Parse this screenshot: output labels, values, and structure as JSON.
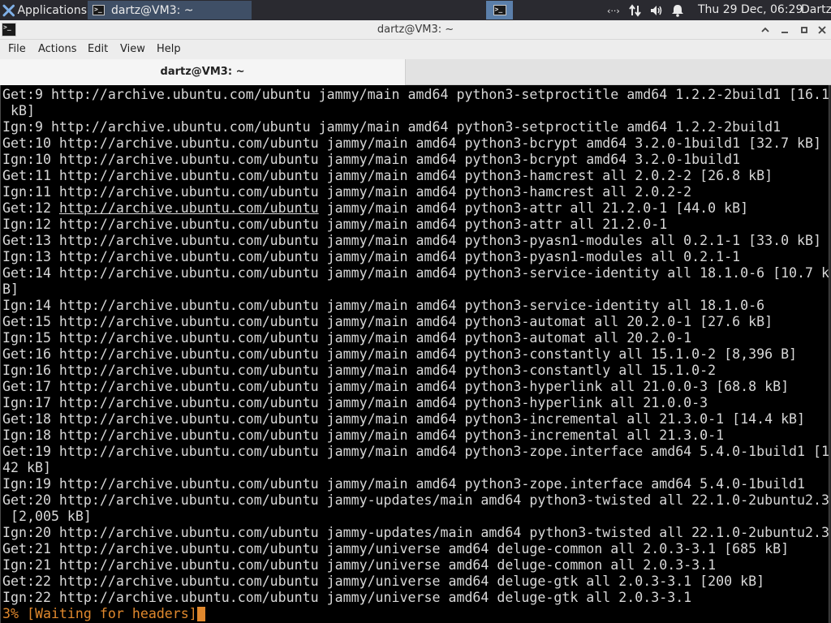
{
  "panel": {
    "applications_label": "Applications",
    "task_title": "dartz@VM3: ~",
    "clock": "Thu 29 Dec, 06:29",
    "user": "Dartz"
  },
  "window": {
    "title": "dartz@VM3: ~",
    "tab_title": "dartz@VM3: ~"
  },
  "menu": {
    "file": "File",
    "actions": "Actions",
    "edit": "Edit",
    "view": "View",
    "help": "Help"
  },
  "colors": {
    "terminal_bg": "#000000",
    "terminal_fg": "#d8d8d8",
    "status_orange": "#e0882d",
    "active_task": "#3f4f66",
    "workspace_active": "#5b7faa"
  },
  "terminal": {
    "lines": [
      "Get:9 http://archive.ubuntu.com/ubuntu jammy/main amd64 python3-setproctitle amd64 1.2.2-2build1 [16.1",
      " kB]",
      "Ign:9 http://archive.ubuntu.com/ubuntu jammy/main amd64 python3-setproctitle amd64 1.2.2-2build1",
      "Get:10 http://archive.ubuntu.com/ubuntu jammy/main amd64 python3-bcrypt amd64 3.2.0-1build1 [32.7 kB]",
      "Ign:10 http://archive.ubuntu.com/ubuntu jammy/main amd64 python3-bcrypt amd64 3.2.0-1build1",
      "Get:11 http://archive.ubuntu.com/ubuntu jammy/main amd64 python3-hamcrest all 2.0.2-2 [26.8 kB]",
      "Ign:11 http://archive.ubuntu.com/ubuntu jammy/main amd64 python3-hamcrest all 2.0.2-2",
      "Get:12 http://archive.ubuntu.com/ubuntu jammy/main amd64 python3-attr all 21.2.0-1 [44.0 kB]",
      "Ign:12 http://archive.ubuntu.com/ubuntu jammy/main amd64 python3-attr all 21.2.0-1",
      "Get:13 http://archive.ubuntu.com/ubuntu jammy/main amd64 python3-pyasn1-modules all 0.2.1-1 [33.0 kB]",
      "Ign:13 http://archive.ubuntu.com/ubuntu jammy/main amd64 python3-pyasn1-modules all 0.2.1-1",
      "Get:14 http://archive.ubuntu.com/ubuntu jammy/main amd64 python3-service-identity all 18.1.0-6 [10.7 k",
      "B]",
      "Ign:14 http://archive.ubuntu.com/ubuntu jammy/main amd64 python3-service-identity all 18.1.0-6",
      "Get:15 http://archive.ubuntu.com/ubuntu jammy/main amd64 python3-automat all 20.2.0-1 [27.6 kB]",
      "Ign:15 http://archive.ubuntu.com/ubuntu jammy/main amd64 python3-automat all 20.2.0-1",
      "Get:16 http://archive.ubuntu.com/ubuntu jammy/main amd64 python3-constantly all 15.1.0-2 [8,396 B]",
      "Ign:16 http://archive.ubuntu.com/ubuntu jammy/main amd64 python3-constantly all 15.1.0-2",
      "Get:17 http://archive.ubuntu.com/ubuntu jammy/main amd64 python3-hyperlink all 21.0.0-3 [68.8 kB]",
      "Ign:17 http://archive.ubuntu.com/ubuntu jammy/main amd64 python3-hyperlink all 21.0.0-3",
      "Get:18 http://archive.ubuntu.com/ubuntu jammy/main amd64 python3-incremental all 21.3.0-1 [14.4 kB]",
      "Ign:18 http://archive.ubuntu.com/ubuntu jammy/main amd64 python3-incremental all 21.3.0-1",
      "Get:19 http://archive.ubuntu.com/ubuntu jammy/main amd64 python3-zope.interface amd64 5.4.0-1build1 [1",
      "42 kB]",
      "Ign:19 http://archive.ubuntu.com/ubuntu jammy/main amd64 python3-zope.interface amd64 5.4.0-1build1",
      "Get:20 http://archive.ubuntu.com/ubuntu jammy-updates/main amd64 python3-twisted all 22.1.0-2ubuntu2.3",
      " [2,005 kB]",
      "Ign:20 http://archive.ubuntu.com/ubuntu jammy-updates/main amd64 python3-twisted all 22.1.0-2ubuntu2.3",
      "Get:21 http://archive.ubuntu.com/ubuntu jammy/universe amd64 deluge-common all 2.0.3-3.1 [685 kB]",
      "Ign:21 http://archive.ubuntu.com/ubuntu jammy/universe amd64 deluge-common all 2.0.3-3.1",
      "Get:22 http://archive.ubuntu.com/ubuntu jammy/universe amd64 deluge-gtk all 2.0.3-3.1 [200 kB]",
      "Ign:22 http://archive.ubuntu.com/ubuntu jammy/universe amd64 deluge-gtk all 2.0.3-3.1"
    ],
    "link_line_index": 7,
    "link_prefix": "Get:12 ",
    "link_text": "http://archive.ubuntu.com/ubuntu",
    "status": "3% [Waiting for headers]"
  }
}
